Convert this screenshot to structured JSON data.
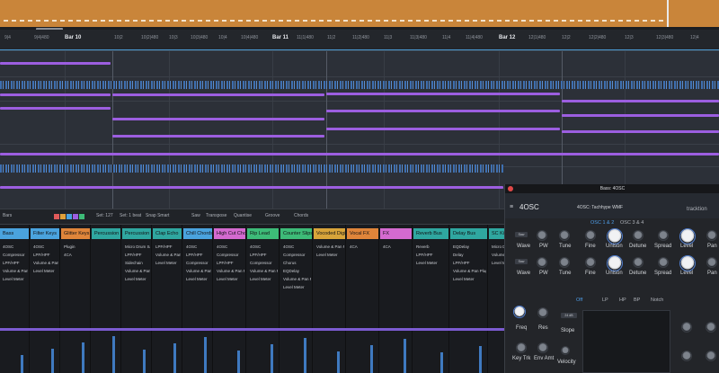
{
  "ruler": {
    "bars": [
      {
        "label": "Bar 10"
      },
      {
        "label": "Bar 11"
      },
      {
        "label": "Bar 12"
      }
    ],
    "ticks": [
      {
        "label": "9|4"
      },
      {
        "label": "9|4|480"
      },
      {
        "label": "10|2"
      },
      {
        "label": "10|2|480"
      },
      {
        "label": "10|3"
      },
      {
        "label": "10|3|480"
      },
      {
        "label": "10|4"
      },
      {
        "label": "10|4|480"
      },
      {
        "label": "11|1|480"
      },
      {
        "label": "11|2"
      },
      {
        "label": "11|2|480"
      },
      {
        "label": "11|3"
      },
      {
        "label": "11|3|480"
      },
      {
        "label": "11|4"
      },
      {
        "label": "11|4|480"
      },
      {
        "label": "12|1|480"
      },
      {
        "label": "12|2"
      },
      {
        "label": "12|2|480"
      },
      {
        "label": "12|3"
      },
      {
        "label": "12|3|480"
      },
      {
        "label": "12|4"
      }
    ]
  },
  "toolbar": {
    "bars_label": "Bars",
    "set_value": "Set: 127",
    "time_value": "Set: 1 beat",
    "snap_label": "Snap Smart",
    "saw_label": "Saw",
    "transpose_label": "Transpose",
    "quantise_label": "Quantise",
    "groove_label": "Groove",
    "chords_label": "Chords"
  },
  "tracks": [
    {
      "name": "Bass",
      "color": "#4aa3de",
      "plugins": [
        "4OSC",
        "Compressor",
        "LPF/HPF",
        "Volume & Pan Plugin",
        "Level Meter"
      ]
    },
    {
      "name": "Filter Keys",
      "color": "#4aa3de",
      "plugins": [
        "4OSC",
        "LPF/HPF",
        "Volume & Pan Plugin",
        "Level Meter"
      ]
    },
    {
      "name": "Glitter Keys",
      "color": "#e0853a",
      "plugins": [
        "Plugin",
        "4CA"
      ]
    },
    {
      "name": "Percussion",
      "color": "#2fa7a0",
      "plugins": []
    },
    {
      "name": "Percussion",
      "color": "#2fa7a0",
      "plugins": [
        "Micro Drum Sampler",
        "LPF/HPF",
        "Sidechain",
        "Volume & Pan Plugin",
        "Level Meter"
      ]
    },
    {
      "name": "Clap Echo",
      "color": "#2fa7a0",
      "plugins": [
        "LPF/HPF",
        "Volume & Pan Plugin",
        "Level Meter"
      ]
    },
    {
      "name": "Chill Chords",
      "color": "#4aa3de",
      "plugins": [
        "4OSC",
        "LPF/HPF",
        "Compressor",
        "Volume & Pan Plugin",
        "Level Meter"
      ]
    },
    {
      "name": "High Cut Chords",
      "color": "#d46ad0",
      "plugins": [
        "4OSC",
        "Compressor",
        "LPF/HPF",
        "Volume & Pan Plugin",
        "Level Meter"
      ]
    },
    {
      "name": "Rip Lead",
      "color": "#3dbb78",
      "plugins": [
        "4OSC",
        "LPF/HPF",
        "Compressor",
        "Volume & Pan Plugin",
        "Level Meter"
      ]
    },
    {
      "name": "Counter Slips",
      "color": "#3dbb78",
      "plugins": [
        "4OSC",
        "Compressor",
        "Chorus",
        "EQDelay",
        "Volume & Pan Plugin",
        "Level Meter"
      ]
    },
    {
      "name": "Vocoded Digital",
      "color": "#d8a43a",
      "plugins": [
        "Volume & Pan Plugin",
        "Level Meter"
      ]
    },
    {
      "name": "Vocal FX",
      "color": "#e0853a",
      "plugins": [
        "4CA"
      ]
    },
    {
      "name": "FX",
      "color": "#d46ad0",
      "plugins": [
        "4CA"
      ]
    },
    {
      "name": "Reverb Bus",
      "color": "#2fa7a0",
      "plugins": [
        "Reverb",
        "LPF/HPF",
        "Level Meter"
      ]
    },
    {
      "name": "Delay Bus",
      "color": "#2fa7a0",
      "plugins": [
        "EQDelay",
        "Delay",
        "LPF/HPF",
        "Volume & Pan Plugin",
        "Level Meter"
      ]
    },
    {
      "name": "SC Kick",
      "color": "#2fa7a0",
      "plugins": [
        "Micro Drum Sampler",
        "Volume & Pan Plugin",
        "Level Meter"
      ]
    }
  ],
  "plugin": {
    "window_title": "Bass: 4OSC",
    "name": "4OSC",
    "preset": "4OSC: Tachhype WMF",
    "brand": "tracktion",
    "tabs": [
      "OSC 1 & 2",
      "OSC 3 & 4"
    ],
    "osc_labels": [
      "Wave",
      "PW",
      "Tune",
      "Fine",
      "Unison",
      "Detune",
      "Spread",
      "Level",
      "Pan"
    ],
    "osc_button": "Saw",
    "filter_tabs": [
      "Off",
      "LP",
      "HP",
      "BP",
      "Notch"
    ],
    "filter_labels": [
      "Freq",
      "Res",
      "Slope",
      "Key Trk",
      "Env Amt",
      "Velocity"
    ],
    "slope_value": "24 dB",
    "accent": "#4f7ccc"
  }
}
